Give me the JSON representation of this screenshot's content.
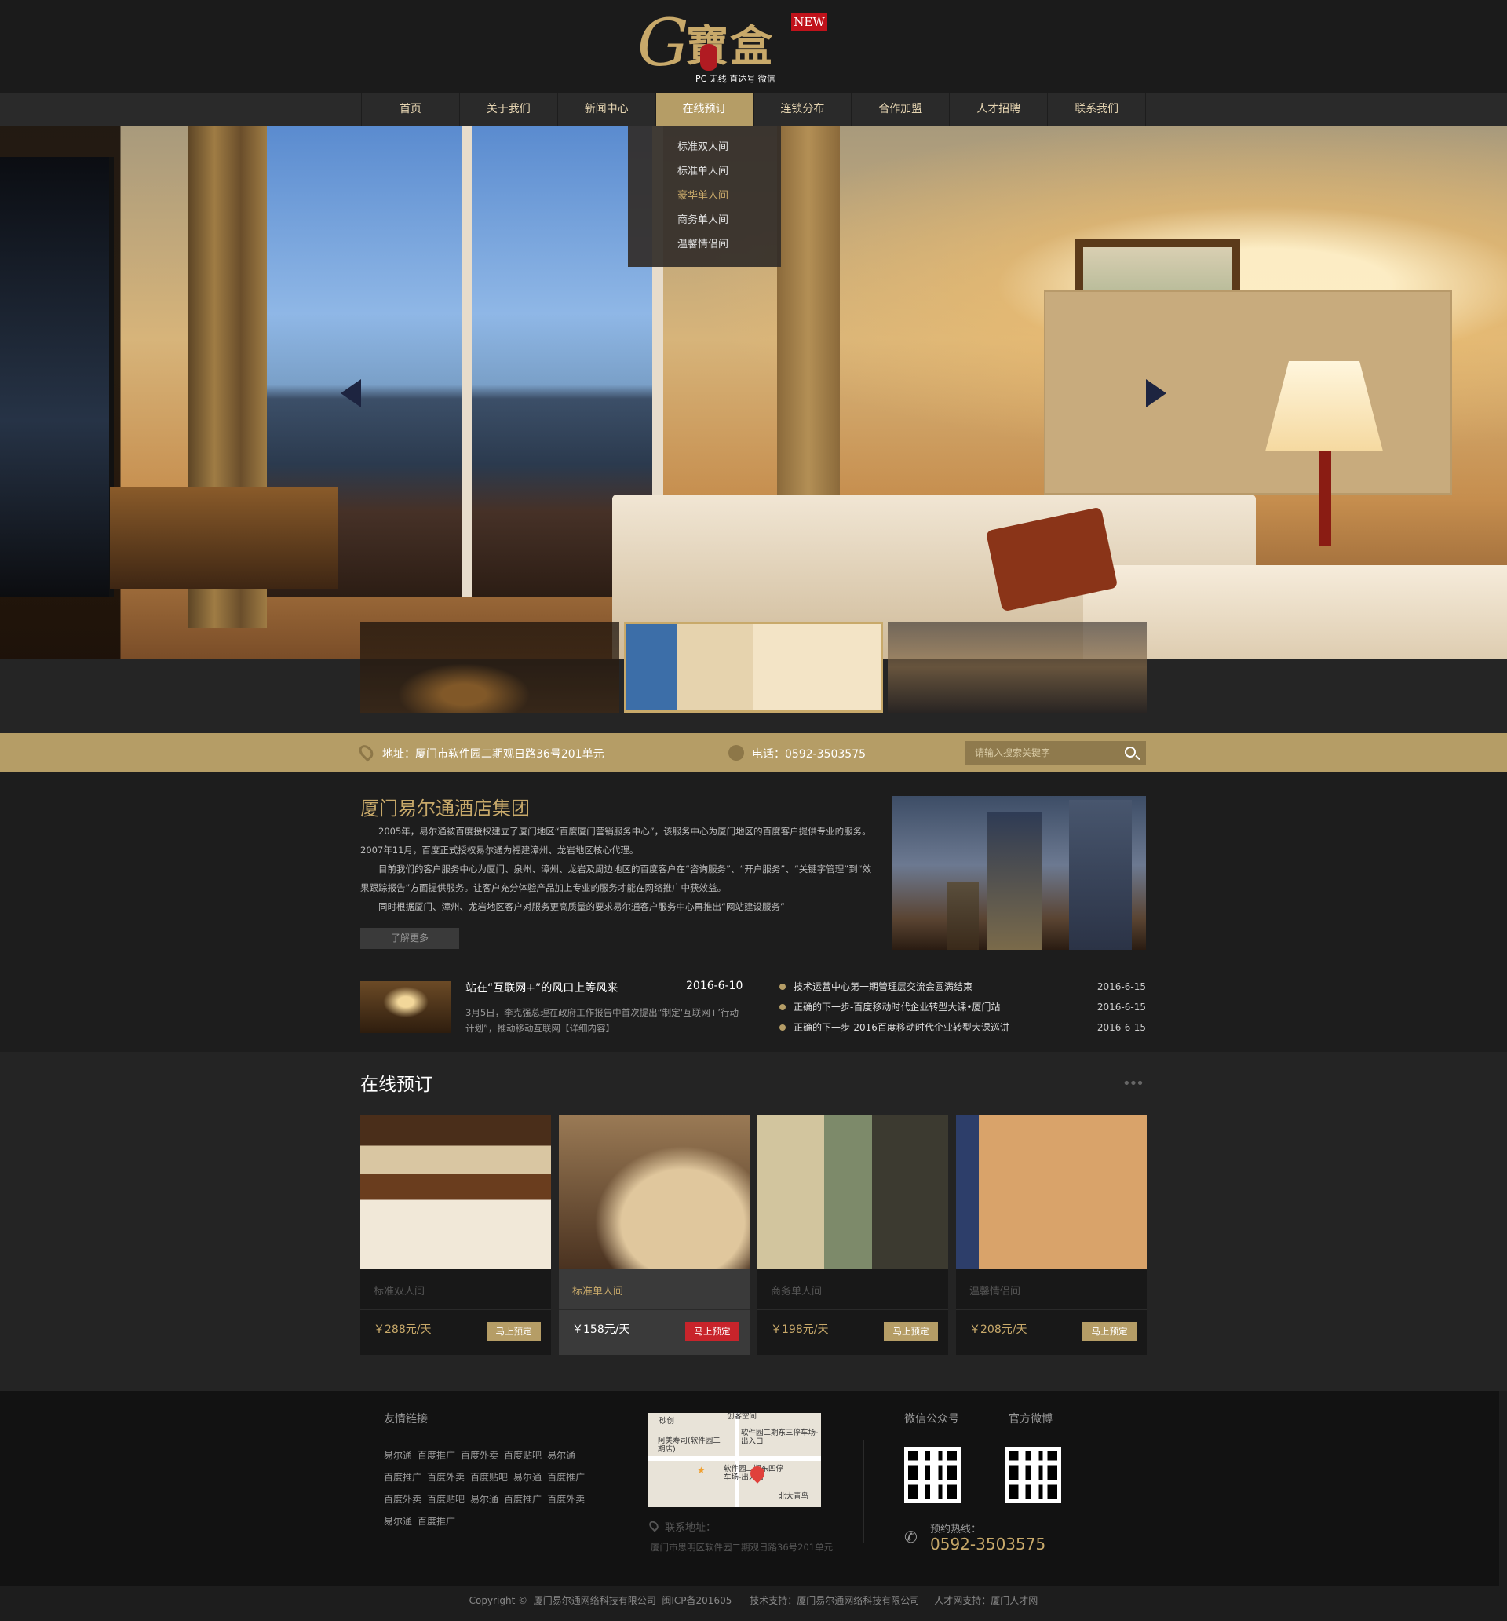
{
  "logo": {
    "mark": "G",
    "chinese": "寶盒",
    "badge": "NEW",
    "subtitle": "PC 无线 直达号 微信"
  },
  "nav": {
    "items": [
      "首页",
      "关于我们",
      "新闻中心",
      "在线预订",
      "连锁分布",
      "合作加盟",
      "人才招聘",
      "联系我们"
    ],
    "active_index": 3
  },
  "dropdown": {
    "items": [
      "标准双人间",
      "标准单人间",
      "豪华单人间",
      "商务单人间",
      "温馨情侣间"
    ],
    "highlight_index": 2
  },
  "infobar": {
    "address": "地址：厦门市软件园二期观日路36号201单元",
    "phone": "电话：0592-3503575",
    "search_placeholder": "请输入搜索关键字"
  },
  "about": {
    "title": "厦门易尔通酒店集团",
    "paragraphs": [
      "2005年，易尔通被百度授权建立了厦门地区“百度厦门营销服务中心”，该服务中心为厦门地区的百度客户提供专业的服务。2007年11月，百度正式授权易尔通为福建漳州、龙岩地区核心代理。",
      "目前我们的客户服务中心为厦门、泉州、漳州、龙岩及周边地区的百度客户在“咨询服务”、“开户服务”、“关键字管理”到“效果跟踪报告”方面提供服务。让客户充分体验产品加上专业的服务才能在网络推广中获效益。",
      "同时根据厦门、漳州、龙岩地区客户对服务更高质量的要求易尔通客户服务中心再推出“网站建设服务”"
    ],
    "more": "了解更多"
  },
  "news": {
    "featured": {
      "title": "站在“互联网+”的风口上等风来",
      "date": "2016-6-10",
      "desc": "3月5日，李克强总理在政府工作报告中首次提出“制定‘互联网+’行动计划”，推动移动互联网【详细内容】"
    },
    "list": [
      {
        "title": "技术运营中心第一期管理层交流会圆满结束",
        "date": "2016-6-15"
      },
      {
        "title": "正确的下一步-百度移动时代企业转型大课•厦门站",
        "date": "2016-6-15"
      },
      {
        "title": "正确的下一步-2016百度移动时代企业转型大课巡讲",
        "date": "2016-6-15"
      }
    ]
  },
  "booking": {
    "title": "在线预订",
    "more": "•••",
    "rooms": [
      {
        "name": "标准双人间",
        "price": "￥288元/天",
        "button": "马上预定"
      },
      {
        "name": "标准单人间",
        "price": "￥158元/天",
        "button": "马上预定"
      },
      {
        "name": "商务单人间",
        "price": "￥198元/天",
        "button": "马上预定"
      },
      {
        "name": "温馨情侣间",
        "price": "￥208元/天",
        "button": "马上预定"
      }
    ],
    "active_index": 1
  },
  "footer": {
    "links_title": "友情链接",
    "links": [
      "易尔通",
      "百度推广",
      "百度外卖",
      "百度贴吧",
      "易尔通",
      "百度推广",
      "百度外卖",
      "百度贴吧",
      "易尔通",
      "百度推广",
      "百度外卖",
      "百度贴吧",
      "易尔通",
      "百度推广",
      "百度外卖",
      "易尔通",
      "百度推广"
    ],
    "map_labels": [
      "砂创",
      "阿美寿司(软件园二期店)",
      "软件园二期东三停车场-出入口",
      "软件园二期东四停车场-出入口",
      "北大青鸟",
      "创客空间"
    ],
    "contact_label": "联系地址：",
    "contact_address": "厦门市思明区软件园二期观日路36号201单元",
    "wechat_label": "微信公众号",
    "weibo_label": "官方微博",
    "hotline_label": "预约热线：",
    "hotline": "0592-3503575",
    "copyright": "Copyright ©  厦门易尔通网络科技有限公司  闽ICP备201605      技术支持：厦门易尔通网络科技有限公司     人才网支持：厦门人才网"
  },
  "colors": {
    "gold": "#b59d66",
    "gold_text": "#c8a96a",
    "red_button": "#c8242b",
    "background": "#1d1d1d"
  }
}
